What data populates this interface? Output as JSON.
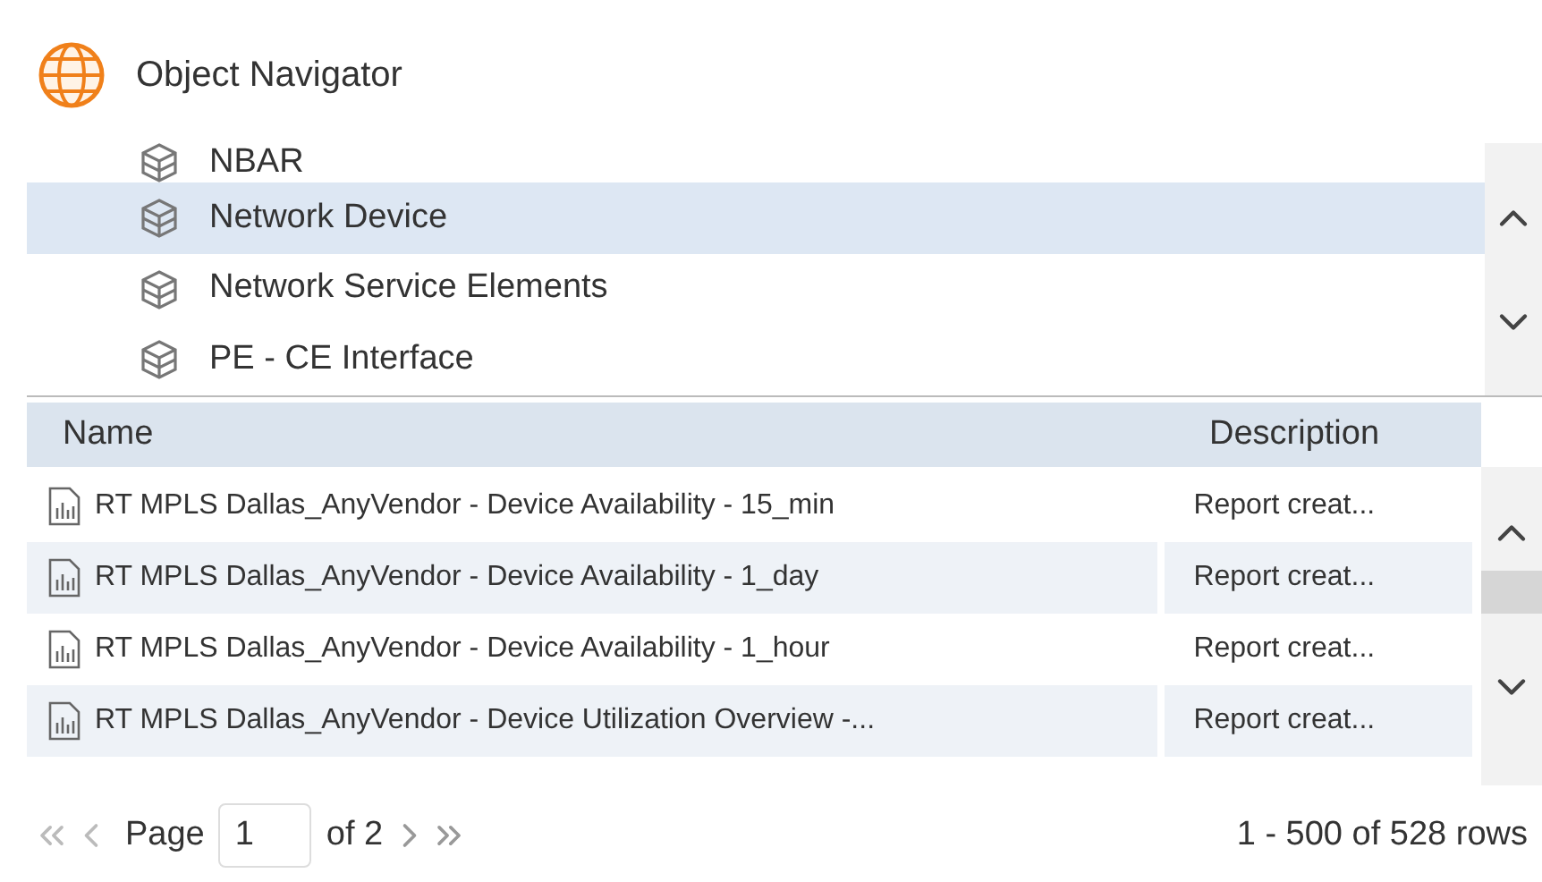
{
  "window": {
    "title": "Object Navigator"
  },
  "tree": {
    "items": [
      {
        "label": "NBAR",
        "selected": false
      },
      {
        "label": "Network Device",
        "selected": true
      },
      {
        "label": "Network Service Elements",
        "selected": false
      },
      {
        "label": "PE - CE Interface",
        "selected": false
      }
    ]
  },
  "table": {
    "columns": [
      "Name",
      "Description"
    ],
    "rows": [
      {
        "name": "RT MPLS Dallas_AnyVendor - Device Availability - 15_min",
        "description": "Report creat..."
      },
      {
        "name": "RT MPLS Dallas_AnyVendor - Device Availability - 1_day",
        "description": "Report creat..."
      },
      {
        "name": "RT MPLS Dallas_AnyVendor - Device Availability - 1_hour",
        "description": "Report creat..."
      },
      {
        "name": "RT MPLS Dallas_AnyVendor - Device Utilization Overview -...",
        "description": "Report creat..."
      }
    ]
  },
  "pager": {
    "page_label": "Page",
    "page": "1",
    "of_label": "of 2",
    "summary": "1 - 500 of 528 rows"
  }
}
